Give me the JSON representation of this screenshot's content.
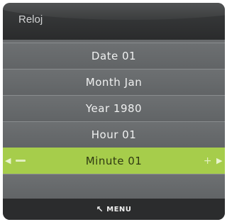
{
  "window": {
    "title": "Reloj"
  },
  "menu": {
    "items": [
      {
        "label": "Date 01"
      },
      {
        "label": "Month Jan"
      },
      {
        "label": "Year 1980"
      },
      {
        "label": "Hour 01"
      },
      {
        "label": "Minute 01",
        "selected": true
      }
    ]
  },
  "selection": {
    "left_arrow": "◀",
    "right_arrow": "▶",
    "plus": "+"
  },
  "footer": {
    "back_icon": "↖",
    "menu_label": "MENU"
  },
  "colors": {
    "selected_row": "#a6cd4b",
    "title_bar": "#2e3031",
    "row_background": "#676a6c",
    "footer": "#2b2c2d"
  }
}
